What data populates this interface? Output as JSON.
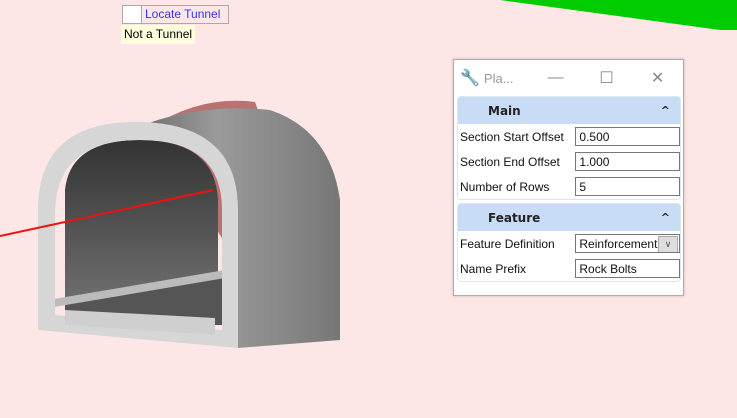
{
  "toolbar": {
    "locate_label": "Locate Tunnel",
    "tooltip": "Not a Tunnel"
  },
  "dialog": {
    "title": "Pla...",
    "minimize": "—",
    "maximize": "☐",
    "close": "✕",
    "sections": [
      {
        "title": "Main",
        "collapse": "^",
        "fields": [
          {
            "label": "Section Start Offset",
            "value": "0.500"
          },
          {
            "label": "Section End Offset",
            "value": "1.000"
          },
          {
            "label": "Number of Rows",
            "value": "5"
          }
        ]
      },
      {
        "title": "Feature",
        "collapse": "^",
        "fields": [
          {
            "label": "Feature Definition",
            "value": "Reinforcement"
          },
          {
            "label": "Name Prefix",
            "value": "Rock Bolts"
          }
        ]
      }
    ]
  },
  "colors": {
    "background": "#fde6e6",
    "green": "#00cc00",
    "axis_red": "#ee1111"
  }
}
